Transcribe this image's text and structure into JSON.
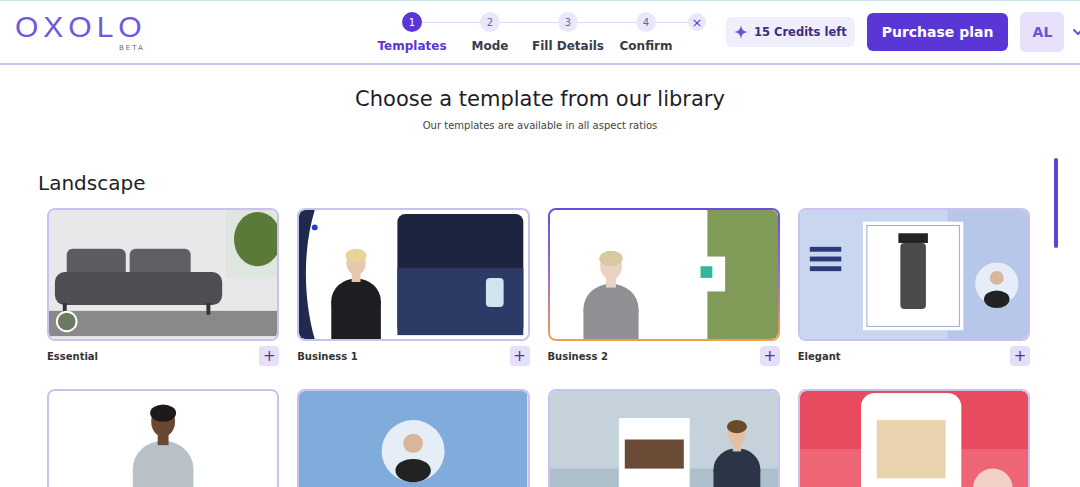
{
  "logo": {
    "name": "OXOLO",
    "tag": "BETA"
  },
  "stepper": {
    "steps": [
      {
        "number": "1",
        "label": "Templates",
        "selected": true
      },
      {
        "number": "2",
        "label": "Mode",
        "selected": false
      },
      {
        "number": "3",
        "label": "Fill Details",
        "selected": false
      },
      {
        "number": "4",
        "label": "Confirm",
        "selected": false
      }
    ],
    "close": "×"
  },
  "credits": "15 Credits left",
  "purchase_button": "Purchase plan",
  "avatar": "AL",
  "heading": "Choose a template from our library",
  "subheading": "Our templates are available in all aspect ratios",
  "section": {
    "title": "Landscape",
    "cards": [
      {
        "label": "Essential",
        "add": "+",
        "selected": false
      },
      {
        "label": "Business 1",
        "add": "+",
        "selected": false
      },
      {
        "label": "Business 2",
        "add": "+",
        "selected": true
      },
      {
        "label": "Elegant",
        "add": "+",
        "selected": false
      }
    ],
    "partial_cards": [
      {
        "selected": false
      },
      {
        "selected": false
      },
      {
        "selected": false
      },
      {
        "selected": false
      }
    ]
  }
}
